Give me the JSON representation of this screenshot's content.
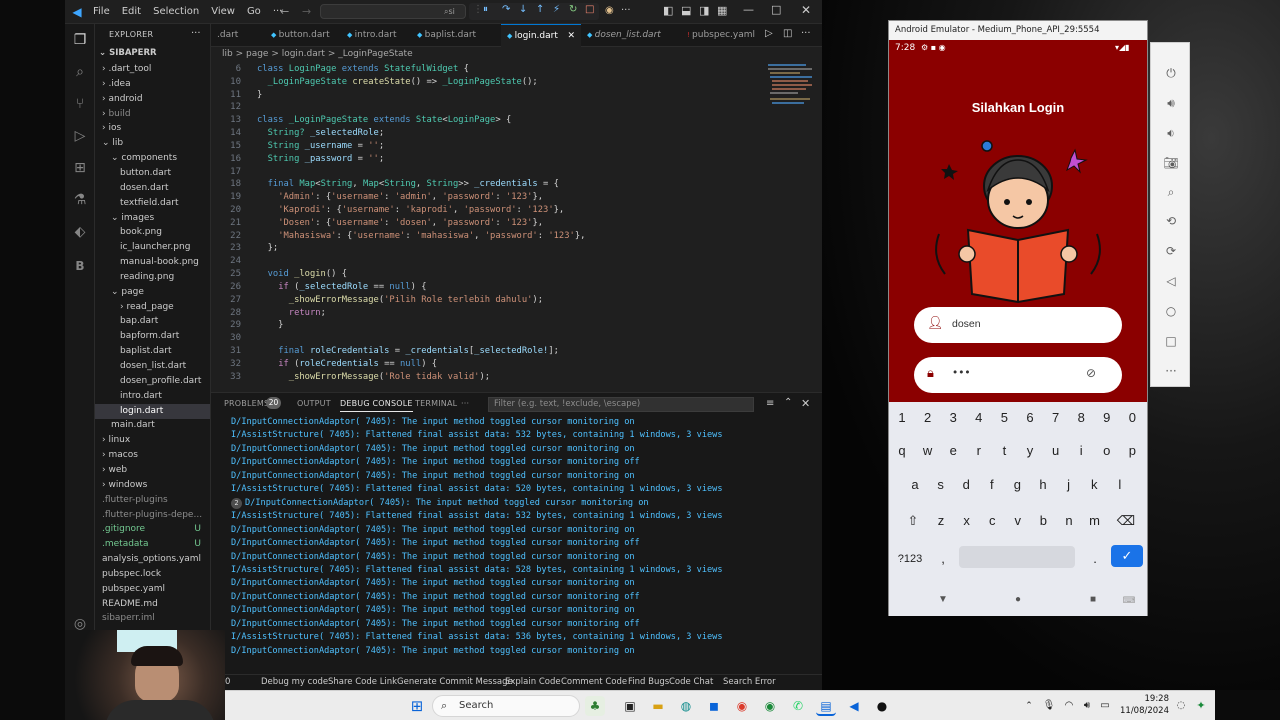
{
  "vscode": {
    "menu": [
      "File",
      "Edit",
      "Selection",
      "View",
      "Go",
      "···"
    ],
    "search_placeholder": "si",
    "explorer_title": "EXPLORER",
    "root": "SIBAPERR",
    "tree": [
      {
        "label": ".dart_tool",
        "kind": "folder",
        "depth": 1,
        "color": "#cccccc"
      },
      {
        "label": ".idea",
        "kind": "folder",
        "depth": 1,
        "color": "#cccccc"
      },
      {
        "label": "android",
        "kind": "folder",
        "depth": 1,
        "color": "#cccccc"
      },
      {
        "label": "build",
        "kind": "folder",
        "depth": 1,
        "color": "#8c8c8c"
      },
      {
        "label": "ios",
        "kind": "folder",
        "depth": 1,
        "color": "#cccccc"
      },
      {
        "label": "lib",
        "kind": "folder-open",
        "depth": 1,
        "color": "#cccccc"
      },
      {
        "label": "components",
        "kind": "folder-open",
        "depth": 2,
        "color": "#cccccc"
      },
      {
        "label": "button.dart",
        "kind": "file",
        "depth": 3,
        "color": "#cccccc"
      },
      {
        "label": "dosen.dart",
        "kind": "file",
        "depth": 3,
        "color": "#cccccc"
      },
      {
        "label": "textfield.dart",
        "kind": "file",
        "depth": 3,
        "color": "#cccccc"
      },
      {
        "label": "images",
        "kind": "folder-open",
        "depth": 2,
        "color": "#cccccc"
      },
      {
        "label": "book.png",
        "kind": "file",
        "depth": 3,
        "color": "#cccccc"
      },
      {
        "label": "ic_launcher.png",
        "kind": "file",
        "depth": 3,
        "color": "#cccccc"
      },
      {
        "label": "manual-book.png",
        "kind": "file",
        "depth": 3,
        "color": "#cccccc"
      },
      {
        "label": "reading.png",
        "kind": "file",
        "depth": 3,
        "color": "#cccccc"
      },
      {
        "label": "page",
        "kind": "folder-open",
        "depth": 2,
        "color": "#cccccc"
      },
      {
        "label": "read_page",
        "kind": "folder",
        "depth": 3,
        "color": "#cccccc"
      },
      {
        "label": "bap.dart",
        "kind": "file",
        "depth": 3,
        "color": "#cccccc"
      },
      {
        "label": "bapform.dart",
        "kind": "file",
        "depth": 3,
        "color": "#cccccc"
      },
      {
        "label": "baplist.dart",
        "kind": "file",
        "depth": 3,
        "color": "#cccccc"
      },
      {
        "label": "dosen_list.dart",
        "kind": "file",
        "depth": 3,
        "color": "#cccccc"
      },
      {
        "label": "dosen_profile.dart",
        "kind": "file",
        "depth": 3,
        "color": "#cccccc"
      },
      {
        "label": "intro.dart",
        "kind": "file",
        "depth": 3,
        "color": "#cccccc"
      },
      {
        "label": "login.dart",
        "kind": "file",
        "depth": 3,
        "color": "#ffffff",
        "selected": true
      },
      {
        "label": "main.dart",
        "kind": "file",
        "depth": 2,
        "color": "#cccccc"
      },
      {
        "label": "linux",
        "kind": "folder",
        "depth": 1,
        "color": "#cccccc"
      },
      {
        "label": "macos",
        "kind": "folder",
        "depth": 1,
        "color": "#cccccc"
      },
      {
        "label": "web",
        "kind": "folder",
        "depth": 1,
        "color": "#cccccc"
      },
      {
        "label": "windows",
        "kind": "folder",
        "depth": 1,
        "color": "#cccccc"
      },
      {
        "label": ".flutter-plugins",
        "kind": "file",
        "depth": 1,
        "color": "#8c8c8c"
      },
      {
        "label": ".flutter-plugins-depe...",
        "kind": "file",
        "depth": 1,
        "color": "#8c8c8c"
      },
      {
        "label": ".gitignore",
        "kind": "file",
        "depth": 1,
        "color": "#73c991",
        "badge": "U"
      },
      {
        "label": ".metadata",
        "kind": "file",
        "depth": 1,
        "color": "#73c991",
        "badge": "U"
      },
      {
        "label": "analysis_options.yaml",
        "kind": "file",
        "depth": 1,
        "color": "#cccccc"
      },
      {
        "label": "pubspec.lock",
        "kind": "file",
        "depth": 1,
        "color": "#cccccc"
      },
      {
        "label": "pubspec.yaml",
        "kind": "file",
        "depth": 1,
        "color": "#cccccc"
      },
      {
        "label": "README.md",
        "kind": "file",
        "depth": 1,
        "color": "#cccccc"
      },
      {
        "label": "sibaperr.iml",
        "kind": "file",
        "depth": 1,
        "color": "#8c8c8c"
      }
    ],
    "tabs": [
      {
        "label": ".dart",
        "active": false
      },
      {
        "label": "button.dart",
        "active": false
      },
      {
        "label": "intro.dart",
        "active": false
      },
      {
        "label": "baplist.dart",
        "active": false
      },
      {
        "label": "login.dart",
        "active": true
      },
      {
        "label": "dosen_list.dart",
        "active": false
      },
      {
        "label": "pubspec.yaml",
        "active": false
      }
    ],
    "breadcrumb": "lib  >  page  >  login.dart  >  _LoginPageState",
    "code_lines": [
      {
        "n": "6",
        "text": "class LoginPage extends StatefulWidget {"
      },
      {
        "n": "10",
        "text": "  _LoginPageState createState() => _LoginPageState();"
      },
      {
        "n": "11",
        "text": "}"
      },
      {
        "n": "12",
        "text": ""
      },
      {
        "n": "13",
        "text": "class _LoginPageState extends State<LoginPage> {"
      },
      {
        "n": "14",
        "text": "  String? _selectedRole;"
      },
      {
        "n": "15",
        "text": "  String _username = '';"
      },
      {
        "n": "16",
        "text": "  String _password = '';"
      },
      {
        "n": "17",
        "text": ""
      },
      {
        "n": "18",
        "text": "  final Map<String, Map<String, String>> _credentials = {"
      },
      {
        "n": "19",
        "text": "    'Admin': {'username': 'admin', 'password': '123'},"
      },
      {
        "n": "20",
        "text": "    'Kaprodi': {'username': 'kaprodi', 'password': '123'},"
      },
      {
        "n": "21",
        "text": "    'Dosen': {'username': 'dosen', 'password': '123'},"
      },
      {
        "n": "22",
        "text": "    'Mahasiswa': {'username': 'mahasiswa', 'password': '123'},"
      },
      {
        "n": "23",
        "text": "  };"
      },
      {
        "n": "24",
        "text": ""
      },
      {
        "n": "25",
        "text": "  void _login() {"
      },
      {
        "n": "26",
        "text": "    if (_selectedRole == null) {"
      },
      {
        "n": "27",
        "text": "      _showErrorMessage('Pilih Role terlebih dahulu');"
      },
      {
        "n": "28",
        "text": "      return;"
      },
      {
        "n": "29",
        "text": "    }"
      },
      {
        "n": "30",
        "text": ""
      },
      {
        "n": "31",
        "text": "    final roleCredentials = _credentials[_selectedRole!];"
      },
      {
        "n": "32",
        "text": "    if (roleCredentials == null) {"
      },
      {
        "n": "33",
        "text": "      _showErrorMessage('Role tidak valid');"
      }
    ],
    "panel_tabs": [
      "PROBLEMS",
      "OUTPUT",
      "DEBUG CONSOLE",
      "TERMINAL",
      "···"
    ],
    "problems_count": "20",
    "filter_placeholder": "Filter (e.g. text, !exclude, \\escape)",
    "log_lines": [
      "D/InputConnectionAdaptor( 7405): The input method toggled cursor monitoring on",
      "I/AssistStructure( 7405): Flattened final assist data: 532 bytes, containing 1 windows, 3 views",
      "D/InputConnectionAdaptor( 7405): The input method toggled cursor monitoring on",
      "D/InputConnectionAdaptor( 7405): The input method toggled cursor monitoring off",
      "D/InputConnectionAdaptor( 7405): The input method toggled cursor monitoring on",
      "I/AssistStructure( 7405): Flattened final assist data: 520 bytes, containing 1 windows, 3 views",
      "D/InputConnectionAdaptor( 7405): The input method toggled cursor monitoring on",
      "I/AssistStructure( 7405): Flattened final assist data: 532 bytes, containing 1 windows, 3 views",
      "D/InputConnectionAdaptor( 7405): The input method toggled cursor monitoring on",
      "D/InputConnectionAdaptor( 7405): The input method toggled cursor monitoring off",
      "D/InputConnectionAdaptor( 7405): The input method toggled cursor monitoring on",
      "I/AssistStructure( 7405): Flattened final assist data: 528 bytes, containing 1 windows, 3 views",
      "D/InputConnectionAdaptor( 7405): The input method toggled cursor monitoring on",
      "D/InputConnectionAdaptor( 7405): The input method toggled cursor monitoring off",
      "D/InputConnectionAdaptor( 7405): The input method toggled cursor monitoring on",
      "D/InputConnectionAdaptor( 7405): The input method toggled cursor monitoring off",
      "I/AssistStructure( 7405): Flattened final assist data: 536 bytes, containing 1 windows, 3 views",
      "D/InputConnectionAdaptor( 7405): The input method toggled cursor monitoring on"
    ],
    "repeat_badge": "2",
    "status_items": [
      "0",
      "Debug my code",
      "Share Code Link",
      "Generate Commit Message",
      "Explain Code",
      "Comment Code",
      "Find Bugs",
      "Code Chat",
      "Search Error"
    ]
  },
  "emulator": {
    "title": "Android Emulator - Medium_Phone_API_29:5554",
    "time": "7:28",
    "login_title": "Silahkan Login",
    "username_value": "dosen",
    "password_value": "•••",
    "keys_row_digits": [
      "1",
      "2",
      "3",
      "4",
      "5",
      "6",
      "7",
      "8",
      "9",
      "0"
    ],
    "keys_row1": [
      "q",
      "w",
      "e",
      "r",
      "t",
      "y",
      "u",
      "i",
      "o",
      "p"
    ],
    "keys_row2": [
      "a",
      "s",
      "d",
      "f",
      "g",
      "h",
      "j",
      "k",
      "l"
    ],
    "keys_row3": [
      "z",
      "x",
      "c",
      "v",
      "b",
      "n",
      "m"
    ],
    "sym_key": "?123",
    "comma_key": ",",
    "period_key": ".",
    "colors": {
      "background": "#8b0000",
      "keyboard": "#e8eaf0",
      "accent": "#1a73e8"
    }
  },
  "taskbar": {
    "search_label": "Search",
    "clock_time": "19:28",
    "clock_date": "11/08/2024"
  }
}
